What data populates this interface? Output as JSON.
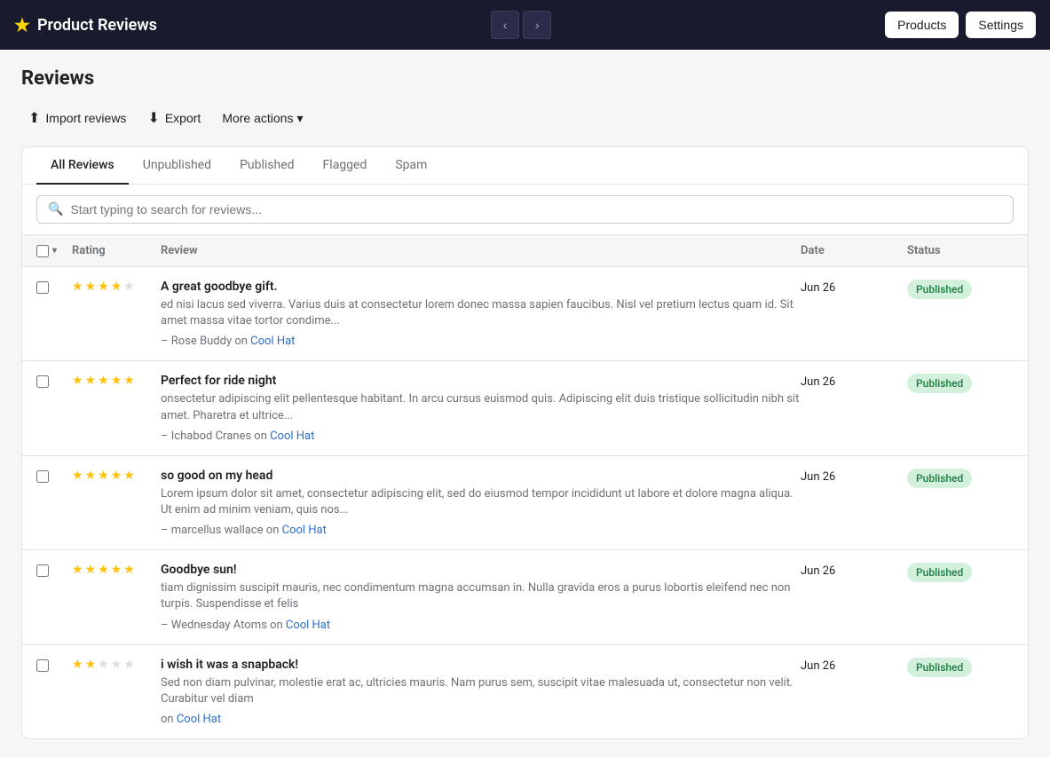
{
  "topbar": {
    "title": "Product Reviews",
    "star": "★",
    "nav": {
      "prev": "‹",
      "next": "›"
    },
    "products_btn": "Products",
    "settings_btn": "Settings"
  },
  "page": {
    "title": "Reviews"
  },
  "toolbar": {
    "import_label": "Import reviews",
    "export_label": "Export",
    "more_actions_label": "More actions",
    "more_actions_chevron": "▾"
  },
  "tabs": [
    {
      "id": "all",
      "label": "All Reviews",
      "active": true
    },
    {
      "id": "unpublished",
      "label": "Unpublished",
      "active": false
    },
    {
      "id": "published",
      "label": "Published",
      "active": false
    },
    {
      "id": "flagged",
      "label": "Flagged",
      "active": false
    },
    {
      "id": "spam",
      "label": "Spam",
      "active": false
    }
  ],
  "search": {
    "placeholder": "Start typing to search for reviews..."
  },
  "table": {
    "columns": {
      "rating": "Rating",
      "review": "Review",
      "date": "Date",
      "status": "Status"
    },
    "rows": [
      {
        "id": 1,
        "rating": 4,
        "title": "A great goodbye gift.",
        "body": "ed nisi lacus sed viverra. Varius duis at consectetur lorem donec massa sapien faucibus. Nisl vel pretium lectus quam id. Sit amet massa vitae tortor condime...",
        "author": "Rose Buddy",
        "product": "Cool Hat",
        "date": "Jun 26",
        "status": "Published",
        "status_type": "published"
      },
      {
        "id": 2,
        "rating": 5,
        "title": "Perfect for ride night",
        "body": "onsectetur adipiscing elit pellentesque habitant. In arcu cursus euismod quis. Adipiscing elit duis tristique sollicitudin nibh sit amet. Pharetra et ultrice...",
        "author": "Ichabod Cranes",
        "product": "Cool Hat",
        "date": "Jun 26",
        "status": "Published",
        "status_type": "published"
      },
      {
        "id": 3,
        "rating": 5,
        "title": "so good on my head",
        "body": "Lorem ipsum dolor sit amet, consectetur adipiscing elit, sed do eiusmod tempor incididunt ut labore et dolore magna aliqua. Ut enim ad minim veniam, quis nos...",
        "author": "marcellus wallace",
        "product": "Cool Hat",
        "date": "Jun 26",
        "status": "Published",
        "status_type": "published"
      },
      {
        "id": 4,
        "rating": 5,
        "title": "Goodbye sun!",
        "body": "tiam dignissim suscipit mauris, nec condimentum magna accumsan in. Nulla gravida eros a purus lobortis eleifend nec non turpis. Suspendisse et felis",
        "author": "Wednesday Atoms",
        "product": "Cool Hat",
        "date": "Jun 26",
        "status": "Published",
        "status_type": "published"
      },
      {
        "id": 5,
        "rating": 2,
        "title": "i wish it was a snapback!",
        "body": "Sed non diam pulvinar, molestie erat ac, ultricies mauris. Nam purus sem, suscipit vitae malesuada ut, consectetur non velit. Curabitur vel diam",
        "author": "",
        "product": "Cool Hat",
        "date": "Jun 26",
        "status": "Published",
        "status_type": "published"
      }
    ]
  }
}
